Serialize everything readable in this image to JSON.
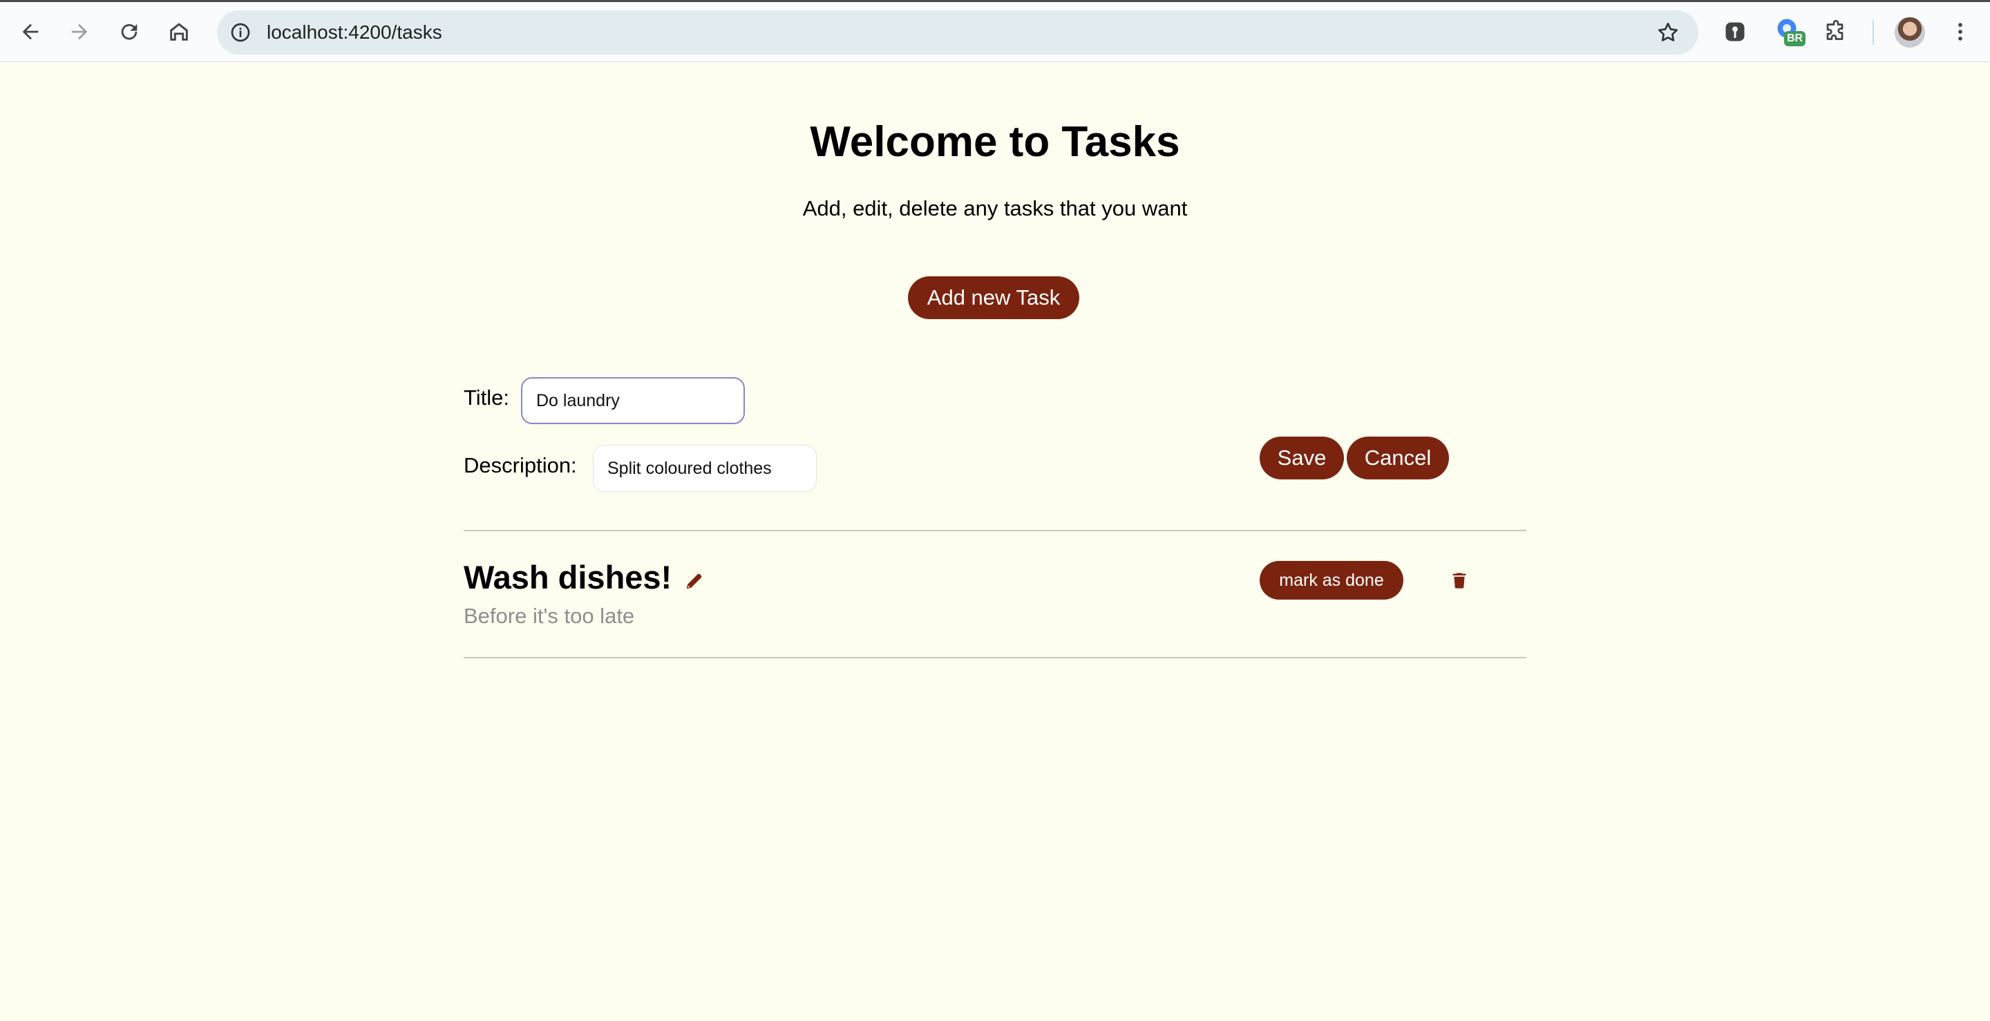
{
  "browser": {
    "url": "localhost:4200/tasks",
    "extension_badge": "BR",
    "icons": [
      "back-icon",
      "forward-icon",
      "reload-icon",
      "home-icon",
      "info-icon",
      "bookmark-star-icon",
      "password-key-icon",
      "extensions-puzzle-icon",
      "menu-dots-icon"
    ]
  },
  "page": {
    "title": "Welcome to Tasks",
    "subtitle": "Add, edit, delete any tasks that you want",
    "add_button": "Add new Task"
  },
  "form": {
    "title_label": "Title:",
    "title_value": "Do laundry",
    "description_label": "Description:",
    "description_value": "Split coloured clothes",
    "save_button": "Save",
    "cancel_button": "Cancel"
  },
  "tasks": [
    {
      "title": "Wash dishes!",
      "description": "Before it's too late",
      "done_button": "mark as done"
    }
  ],
  "colors": {
    "accent": "#7a2410",
    "background": "#fefef0",
    "muted_text": "#8e8e8e"
  }
}
